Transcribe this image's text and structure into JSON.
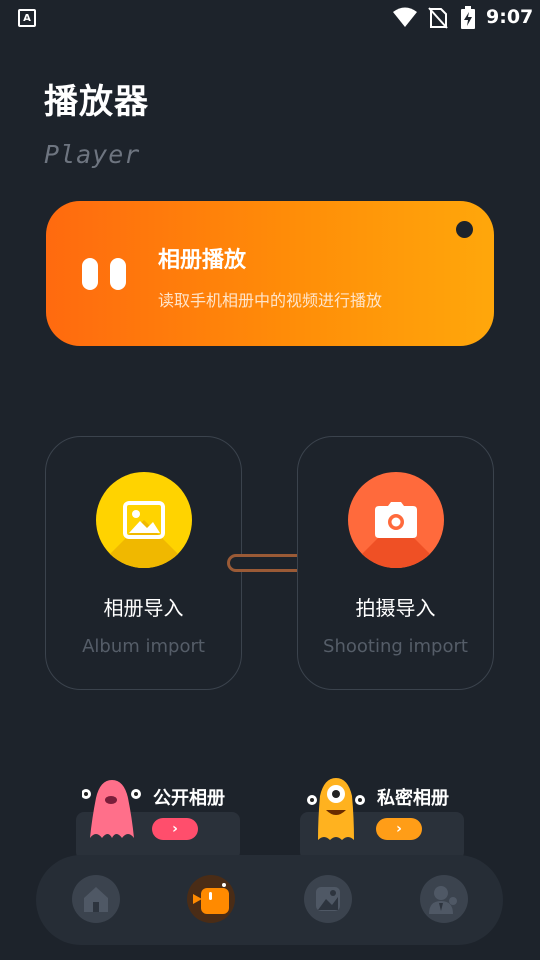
{
  "status_bar": {
    "left_icon": "A",
    "time": "9:07",
    "icons": [
      "wifi-icon",
      "no-sim-icon",
      "battery-charging-icon"
    ]
  },
  "header": {
    "title": "播放器",
    "subtitle": "Player"
  },
  "banner": {
    "title": "相册播放",
    "description": "读取手机相册中的视频进行播放",
    "icon": "pause-icon",
    "gradient": [
      "#ff6a0f",
      "#ffa70b"
    ]
  },
  "import_cards": [
    {
      "title": "相册导入",
      "subtitle": "Album import",
      "icon": "image-icon",
      "color": "#ffd300"
    },
    {
      "title": "拍摄导入",
      "subtitle": "Shooting import",
      "icon": "camera-icon",
      "color": "#ff6a3c"
    }
  ],
  "shortcuts": [
    {
      "label": "公开相册",
      "arrow": "›",
      "color": "#ff4e6c",
      "mascot": "pink-monster-icon"
    },
    {
      "label": "私密相册",
      "arrow": "›",
      "color": "#ff9d17",
      "mascot": "yellow-monster-icon"
    }
  ],
  "bottom_nav": {
    "items": [
      "home-icon",
      "video-camera-icon",
      "gallery-icon",
      "profile-icon"
    ],
    "active": "video-camera-icon",
    "active_color": "#ff8a00"
  }
}
